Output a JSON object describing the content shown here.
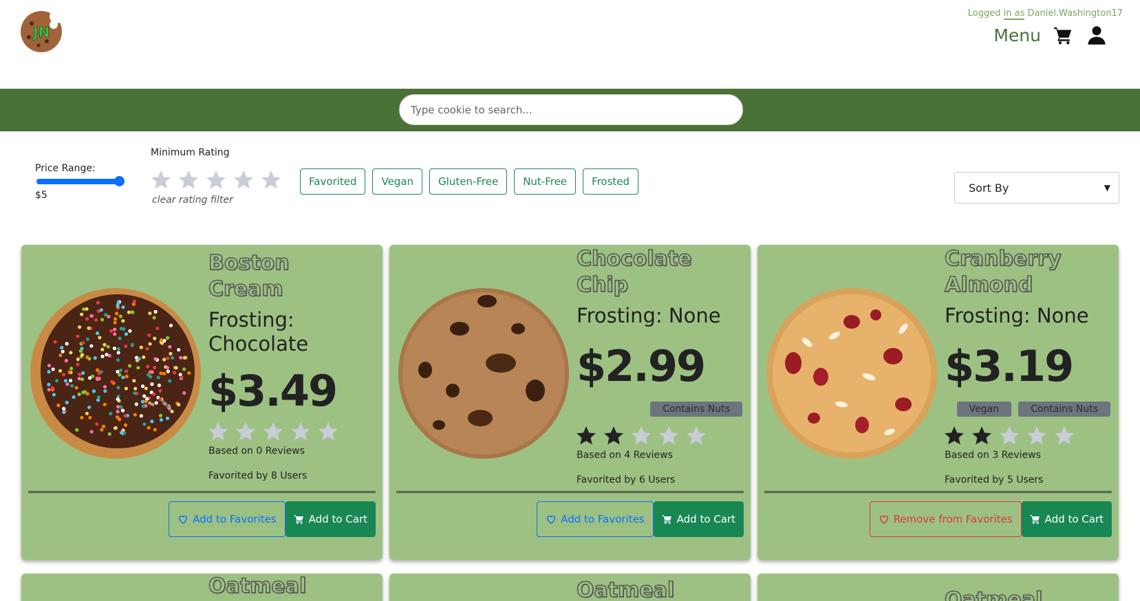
{
  "header": {
    "logo_text": "JN",
    "logged_in_prefix": "Logged ",
    "logged_in_mid": "in as",
    "logged_in_user": " Daniel.Washington17",
    "menu_label": "Menu"
  },
  "search": {
    "placeholder": "Type cookie to search..."
  },
  "filters": {
    "price_label": "Price Range:",
    "price_value": "$5",
    "min_rating_label": "Minimum Rating",
    "clear_rating_label": "clear rating filter",
    "chips": [
      "Favorited",
      "Vegan",
      "Gluten-Free",
      "Nut-Free",
      "Frosted"
    ],
    "sort_label": "Sort By"
  },
  "cards": [
    {
      "name_line1": "Boston",
      "name_line2": "Cream",
      "frosting": "Frosting: Chocolate",
      "price": "$3.49",
      "tags": [],
      "rating": 0,
      "reviews": "Based on 0 Reviews",
      "favorited": "Favorited by 8 Users",
      "fav_button": "Add to Favorites",
      "fav_state": "add",
      "cart_button": "Add to Cart"
    },
    {
      "name_line1": "Chocolate",
      "name_line2": "Chip",
      "frosting": "Frosting: None",
      "price": "$2.99",
      "tags": [
        "Contains Nuts"
      ],
      "rating": 2,
      "reviews": "Based on 4 Reviews",
      "favorited": "Favorited by 6 Users",
      "fav_button": "Add to Favorites",
      "fav_state": "add",
      "cart_button": "Add to Cart"
    },
    {
      "name_line1": "Cranberry",
      "name_line2": "Almond",
      "frosting": "Frosting: None",
      "price": "$3.19",
      "tags": [
        "Vegan",
        "Contains Nuts"
      ],
      "rating": 2,
      "reviews": "Based on 3 Reviews",
      "favorited": "Favorited by 5 Users",
      "fav_button": "Remove from Favorites",
      "fav_state": "remove",
      "cart_button": "Add to Cart"
    }
  ],
  "next_row_names": [
    "Oatmeal",
    "Oatmeal",
    "Oatmeal"
  ],
  "colors": {
    "brand_green": "#4a7236",
    "card_green": "#9dc183",
    "button_green": "#198754",
    "primary_blue": "#0d6efd",
    "danger_red": "#dc3545"
  }
}
